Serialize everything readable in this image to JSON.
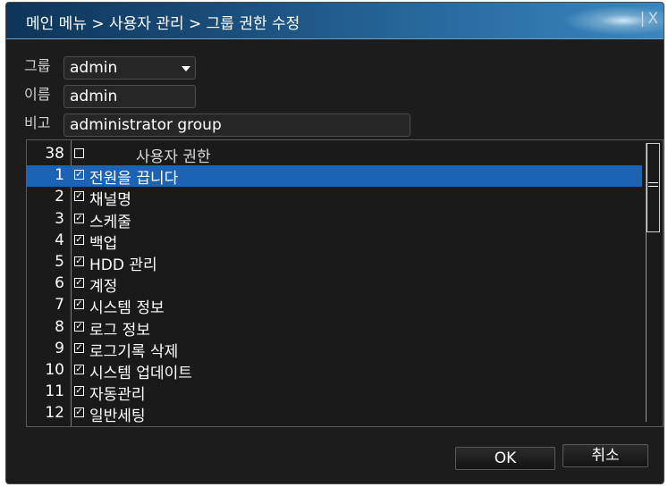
{
  "title": "메인 메뉴 > 사용자 관리 > 그룹 권한 수정",
  "close_label": "X",
  "form": {
    "group_label": "그룹",
    "group_value": "admin",
    "name_label": "이름",
    "name_value": "admin",
    "memo_label": "비고",
    "memo_value": "administrator group"
  },
  "list": {
    "header": {
      "num": "38",
      "checked": false,
      "label": "사용자 권한"
    },
    "rows": [
      {
        "num": "1",
        "checked": true,
        "label": "전원을 끕니다",
        "selected": true
      },
      {
        "num": "2",
        "checked": true,
        "label": "채널명"
      },
      {
        "num": "3",
        "checked": true,
        "label": "스케줄"
      },
      {
        "num": "4",
        "checked": true,
        "label": "백업"
      },
      {
        "num": "5",
        "checked": true,
        "label": "HDD 관리"
      },
      {
        "num": "6",
        "checked": true,
        "label": "계정"
      },
      {
        "num": "7",
        "checked": true,
        "label": "시스템 정보"
      },
      {
        "num": "8",
        "checked": true,
        "label": "로그 정보"
      },
      {
        "num": "9",
        "checked": true,
        "label": "로그기록 삭제"
      },
      {
        "num": "10",
        "checked": true,
        "label": "시스템 업데이트"
      },
      {
        "num": "11",
        "checked": true,
        "label": "자동관리"
      },
      {
        "num": "12",
        "checked": true,
        "label": "일반세팅"
      }
    ]
  },
  "buttons": {
    "ok": "OK",
    "cancel": "취소"
  },
  "colors": {
    "selection": "#1d63b4",
    "title_bar": "#1b4f7c",
    "background": "#1c1c1c"
  }
}
